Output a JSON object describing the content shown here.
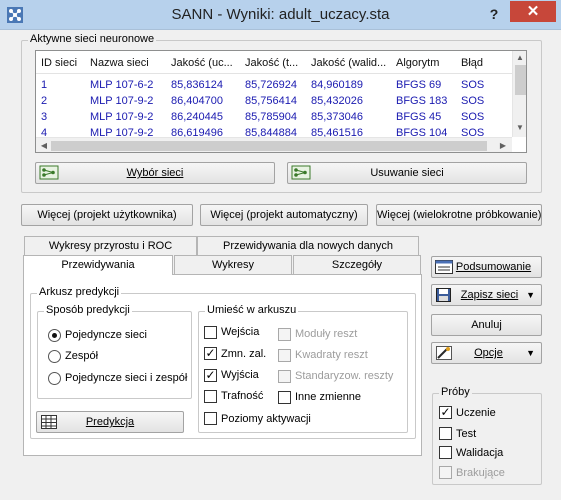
{
  "window": {
    "title": "SANN - Wyniki: adult_uczacy.sta",
    "help": "?",
    "close": "✕"
  },
  "networks_group": {
    "title": "Aktywne sieci neuronowe",
    "columns": [
      "ID sieci",
      "Nazwa sieci",
      "Jakość (uc...",
      "Jakość (t...",
      "Jakość (walid...",
      "Algorytm",
      "Błąd"
    ],
    "rows": [
      [
        "1",
        "MLP 107-6-2",
        "85,836124",
        "85,726924",
        "84,960189",
        "BFGS 69",
        "SOS"
      ],
      [
        "2",
        "MLP 107-9-2",
        "86,404700",
        "85,756414",
        "85,432026",
        "BFGS 183",
        "SOS"
      ],
      [
        "3",
        "MLP 107-9-2",
        "86,240445",
        "85,785904",
        "85,373046",
        "BFGS 45",
        "SOS"
      ],
      [
        "4",
        "MLP 107-9-2",
        "86,619496",
        "85,844884",
        "85,461516",
        "BFGS 104",
        "SOS"
      ]
    ],
    "select_button": "Wybór sieci",
    "remove_button": "Usuwanie sieci"
  },
  "more_buttons": {
    "user_project": "Więcej (projekt użytkownika)",
    "auto_project": "Więcej (projekt automatyczny)",
    "multi_sampling": "Więcej (wielokrotne próbkowanie)"
  },
  "tabs": {
    "row1": [
      "Wykresy przyrostu i ROC",
      "Przewidywania dla nowych danych"
    ],
    "row2": [
      "Przewidywania",
      "Wykresy",
      "Szczegóły"
    ]
  },
  "prediction": {
    "group_title": "Arkusz predykcji",
    "method_title": "Sposób predykcji",
    "methods": [
      "Pojedyncze sieci",
      "Zespół",
      "Pojedyncze sieci i zespół"
    ],
    "selected_method": 0,
    "place_title": "Umieść w arkuszu",
    "place_left": [
      {
        "label": "Wejścia",
        "checked": false,
        "enabled": true
      },
      {
        "label": "Zmn. zal.",
        "checked": true,
        "enabled": true
      },
      {
        "label": "Wyjścia",
        "checked": true,
        "enabled": true
      },
      {
        "label": "Trafność",
        "checked": false,
        "enabled": true
      },
      {
        "label": "Poziomy aktywacji",
        "checked": false,
        "enabled": true
      }
    ],
    "place_right": [
      {
        "label": "Moduły reszt",
        "checked": false,
        "enabled": false
      },
      {
        "label": "Kwadraty reszt",
        "checked": false,
        "enabled": false
      },
      {
        "label": "Standaryzow. reszty",
        "checked": false,
        "enabled": false
      },
      {
        "label": "Inne zmienne",
        "checked": false,
        "enabled": true
      }
    ],
    "predict_button": "Predykcja"
  },
  "side": {
    "summary": "Podsumowanie",
    "save": "Zapisz sieci",
    "cancel": "Anuluj",
    "options": "Opcje",
    "samples_title": "Próby",
    "samples": [
      {
        "label": "Uczenie",
        "checked": true,
        "enabled": true
      },
      {
        "label": "Test",
        "checked": false,
        "enabled": true
      },
      {
        "label": "Walidacja",
        "checked": false,
        "enabled": true
      },
      {
        "label": "Brakujące",
        "checked": false,
        "enabled": false
      }
    ]
  }
}
